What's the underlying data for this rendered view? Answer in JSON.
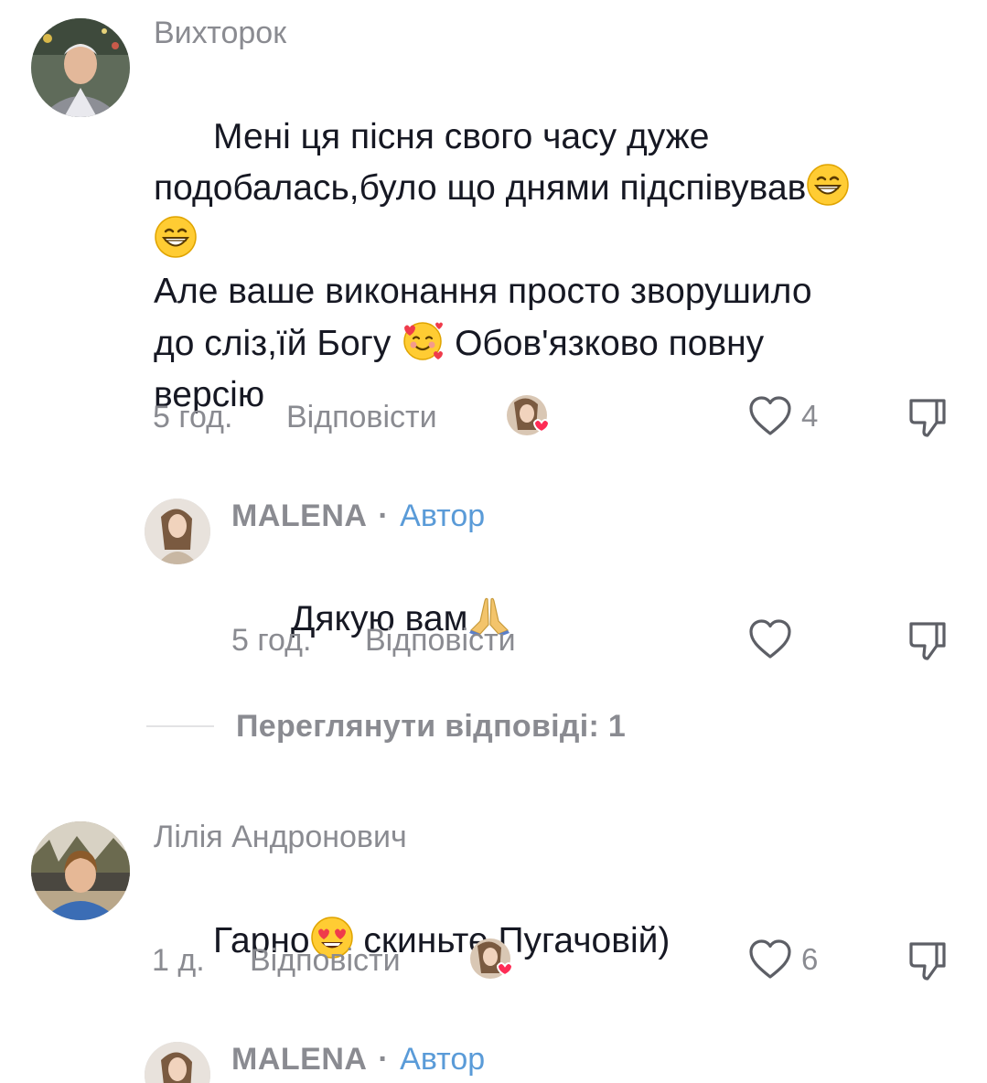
{
  "comments": [
    {
      "author": "Вихторок",
      "text_parts": [
        "Мені ця пісня свого часу дуже\nподобалась,було що днями підспівував",
        "😁",
        "\n",
        "😁",
        "\nАле ваше виконання просто зворушило\nдо сліз,їй Богу ",
        "🥰",
        " Обов'язково повну\nверсію"
      ],
      "time": "5 год.",
      "reply_label": "Відповісти",
      "likes": "4",
      "liked_by_creator": true,
      "replies": [
        {
          "author": "MALENA",
          "separator": "·",
          "tag": "Автор",
          "text_parts": [
            "Дякую вам",
            "🙏"
          ],
          "time": "5 год.",
          "reply_label": "Відповісти"
        }
      ],
      "view_replies_label": "Переглянути відповіді: 1"
    },
    {
      "author": "Лілія Андронович",
      "text_parts": [
        "Гарно",
        "😍",
        " скиньте Пугачовій)"
      ],
      "time": "1 д.",
      "reply_label": "Відповісти",
      "likes": "6",
      "liked_by_creator": true,
      "replies": [
        {
          "author": "MALENA",
          "separator": "·",
          "tag": "Автор"
        }
      ]
    }
  ],
  "icons": {
    "like": "heart-outline-icon",
    "dislike": "thumbs-down-icon",
    "creator_like": "creator-avatar-heart-icon"
  },
  "colors": {
    "author_tag": "#5a9bd8",
    "meta": "#8a8b91",
    "text": "#161823",
    "heart_badge": "#fe2c55"
  }
}
